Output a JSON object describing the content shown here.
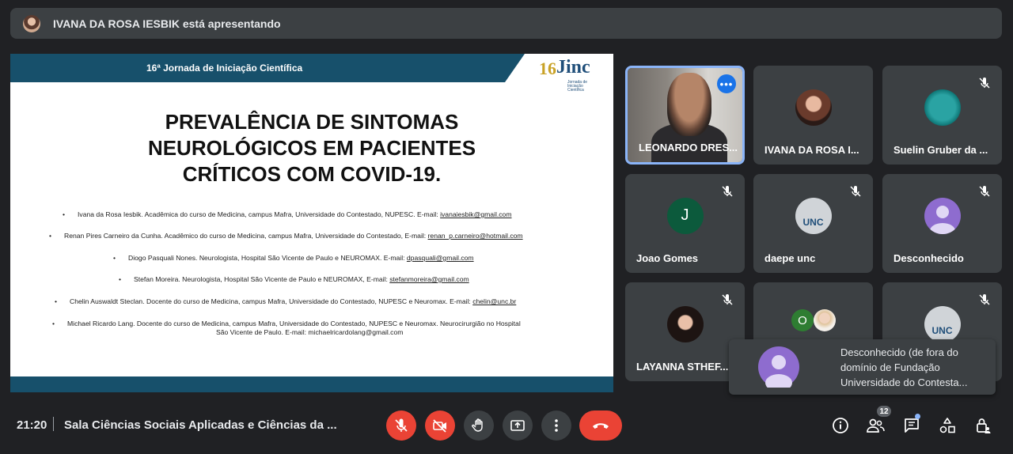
{
  "presenter": {
    "text": "IVANA DA ROSA IESBIK está apresentando"
  },
  "slide": {
    "conference": "16ª Jornada de Iniciação Científica",
    "logo": {
      "number": "16",
      "mark": "Jinc",
      "sub": "Jornada de Iniciação Científica"
    },
    "title_lines": [
      "PREVALÊNCIA DE SINTOMAS",
      "NEUROLÓGICOS EM PACIENTES",
      "CRÍTICOS COM COVID-19."
    ],
    "authors": [
      {
        "text": "Ivana da Rosa Iesbik. Acadêmica do curso de Medicina, campus Mafra, Universidade do Contestado, NUPESC. E-mail: ",
        "email": "ivanaiesbik@gmail.com"
      },
      {
        "text": "Renan Pires Carneiro da Cunha. Acadêmico do curso de Medicina, campus Mafra, Universidade do Contestado, E-mail: ",
        "email": "renan_p.carneiro@hotmail.com"
      },
      {
        "text": "Diogo Pasquali Nones. Neurologista, Hospital São Vicente de Paulo e NEUROMAX. E-mail: ",
        "email": "dpasquali@gmail.com"
      },
      {
        "text": "Stefan Moreira. Neurologista, Hospital São Vicente de Paulo e NEUROMAX, E-mail: ",
        "email": "stefanmoreira@gmail.com"
      },
      {
        "text": "Chelin Auswaldt Steclan. Docente do curso de Medicina, campus Mafra, Universidade do Contestado, NUPESC e Neuromax. E-mail: ",
        "email": "chelin@unc.br"
      },
      {
        "text": "Michael Ricardo Lang. Docente do curso de Medicina, campus Mafra, Universidade do Contestado, NUPESC e Neuromax. Neurocirurgião no Hospital",
        "line2": "São Vicente de Paulo. E-mail: michaelricardolang@gmail.com"
      }
    ]
  },
  "participants": [
    {
      "name": "LEONARDO DRES...",
      "type": "video"
    },
    {
      "name": "IVANA DA ROSA I...",
      "type": "photo"
    },
    {
      "name": "Suelin Gruber da ...",
      "type": "photo"
    },
    {
      "name": "Joao Gomes",
      "type": "letter",
      "letter": "J"
    },
    {
      "name": "daepe unc",
      "type": "logo",
      "logo": "UNC"
    },
    {
      "name": "Desconhecido",
      "type": "anon"
    },
    {
      "name": "LAYANNA STHEF...",
      "type": "photo"
    },
    {
      "name": "",
      "type": "group",
      "letter": "O"
    },
    {
      "name": "",
      "type": "logo",
      "logo": "UNC"
    }
  ],
  "notification": {
    "text": "Desconhecido (de fora do domínio de Fundação Universidade do Contesta..."
  },
  "bottom": {
    "time": "21:20",
    "meeting": "Sala Ciências Sociais Aplicadas e Ciências da ...",
    "people_count": "12"
  },
  "colors": {
    "accent": "#8ab4f8",
    "danger": "#ea4335",
    "tile": "#3c4043",
    "background": "#202124",
    "slide_blue": "#17506b"
  }
}
